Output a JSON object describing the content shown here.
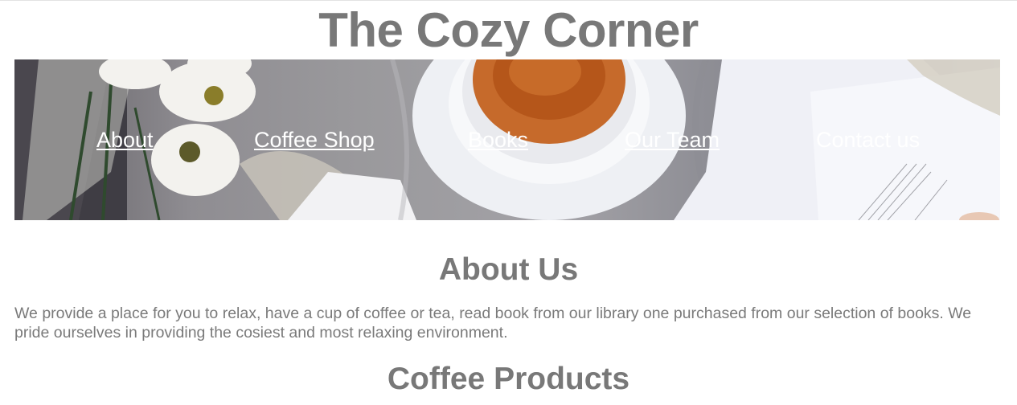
{
  "site": {
    "title": "The Cozy Corner"
  },
  "nav": {
    "items": [
      {
        "label": "About"
      },
      {
        "label": "Coffee Shop"
      },
      {
        "label": "Books"
      },
      {
        "label": "Our Team"
      },
      {
        "label": "Contact us"
      }
    ]
  },
  "about": {
    "heading": "About Us",
    "text": "We provide a place for you to relax, have a cup of coffee or tea, read book from our library one purchased from our selection of books. We pride ourselves in providing the cosiest and most relaxing environment."
  },
  "coffee": {
    "heading": "Coffee Products"
  }
}
